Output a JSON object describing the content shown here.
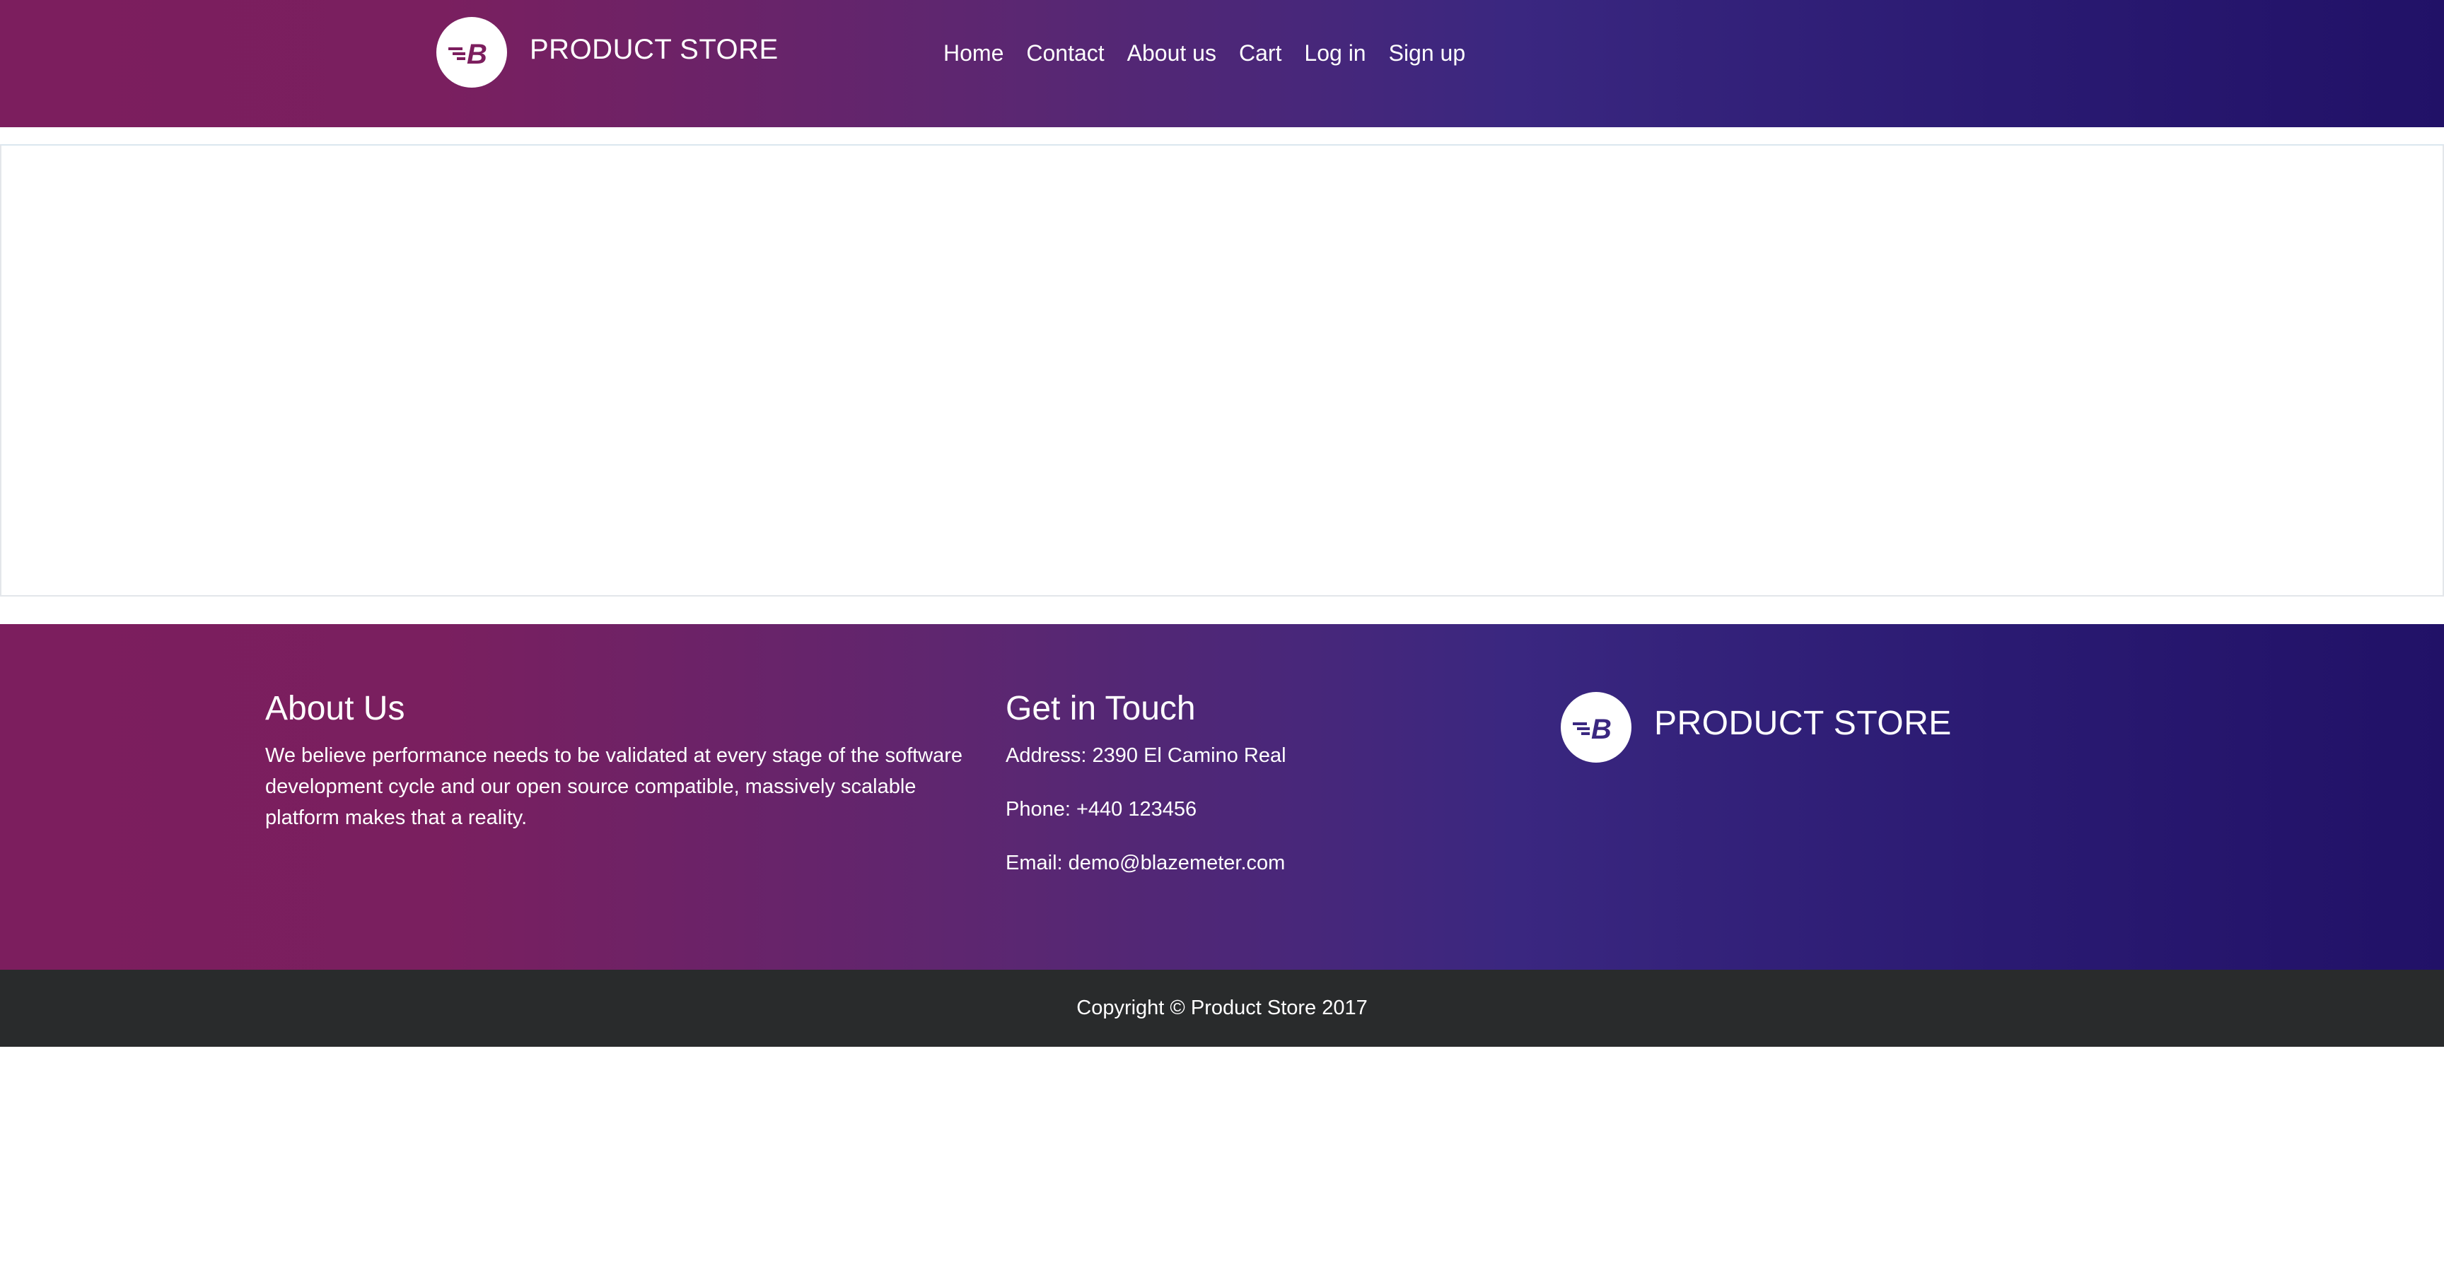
{
  "header": {
    "brand": "PRODUCT STORE",
    "nav": [
      "Home",
      "Contact",
      "About us",
      "Cart",
      "Log in",
      "Sign up"
    ],
    "logo_icon": "blazemeter-b-logo-icon"
  },
  "footer": {
    "about_title": "About Us",
    "about_text": "We believe performance needs to be validated at every stage of the software development cycle and our open source compatible, massively scalable platform makes that a reality.",
    "touch_title": "Get in Touch",
    "address": "Address: 2390 El Camino Real",
    "phone": "Phone: +440 123456",
    "email": "Email: demo@blazemeter.com",
    "brand": "PRODUCT STORE"
  },
  "copyright": "Copyright © Product Store 2017",
  "colors": {
    "gradient_start": "#7c1e5e",
    "gradient_end": "#211167",
    "copyright_bar": "#292b2c"
  }
}
